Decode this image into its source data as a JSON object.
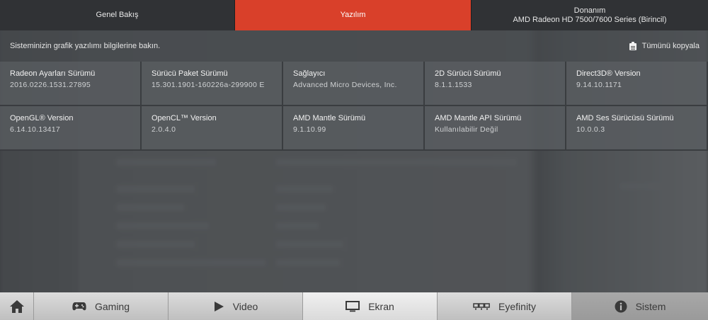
{
  "tabs": [
    {
      "label": "Genel Bakış",
      "sub": ""
    },
    {
      "label": "Yazılım",
      "sub": ""
    },
    {
      "label": "Donanım",
      "sub": "AMD Radeon HD 7500/7600 Series (Birincil)"
    }
  ],
  "infobar": {
    "text": "Sisteminizin grafik yazılımı bilgilerine bakın.",
    "copy_label": "Tümünü kopyala"
  },
  "cells": [
    {
      "label": "Radeon Ayarları Sürümü",
      "value": "2016.0226.1531.27895"
    },
    {
      "label": "Sürücü Paket Sürümü",
      "value": "15.301.1901-160226a-299900 E"
    },
    {
      "label": "Sağlayıcı",
      "value": "Advanced Micro Devices, Inc."
    },
    {
      "label": "2D Sürücü Sürümü",
      "value": "8.1.1.1533"
    },
    {
      "label": "Direct3D® Version",
      "value": "9.14.10.1171"
    },
    {
      "label": "OpenGL® Version",
      "value": "6.14.10.13417"
    },
    {
      "label": "OpenCL™ Version",
      "value": "2.0.4.0"
    },
    {
      "label": "AMD Mantle Sürümü",
      "value": "9.1.10.99"
    },
    {
      "label": "AMD Mantle API Sürümü",
      "value": "Kullanılabilir Değil"
    },
    {
      "label": "AMD Ses Sürücüsü Sürümü",
      "value": "10.0.0.3"
    }
  ],
  "nav": [
    {
      "label": "Gaming",
      "icon": "gamepad-icon"
    },
    {
      "label": "Video",
      "icon": "play-icon"
    },
    {
      "label": "Ekran",
      "icon": "monitor-icon"
    },
    {
      "label": "Eyefinity",
      "icon": "eyefinity-icon"
    },
    {
      "label": "Sistem",
      "icon": "info-icon"
    }
  ],
  "colors": {
    "active_tab": "#d9402a",
    "cell_bg": "#585c60",
    "nav_bg": "#d0d0d0"
  }
}
